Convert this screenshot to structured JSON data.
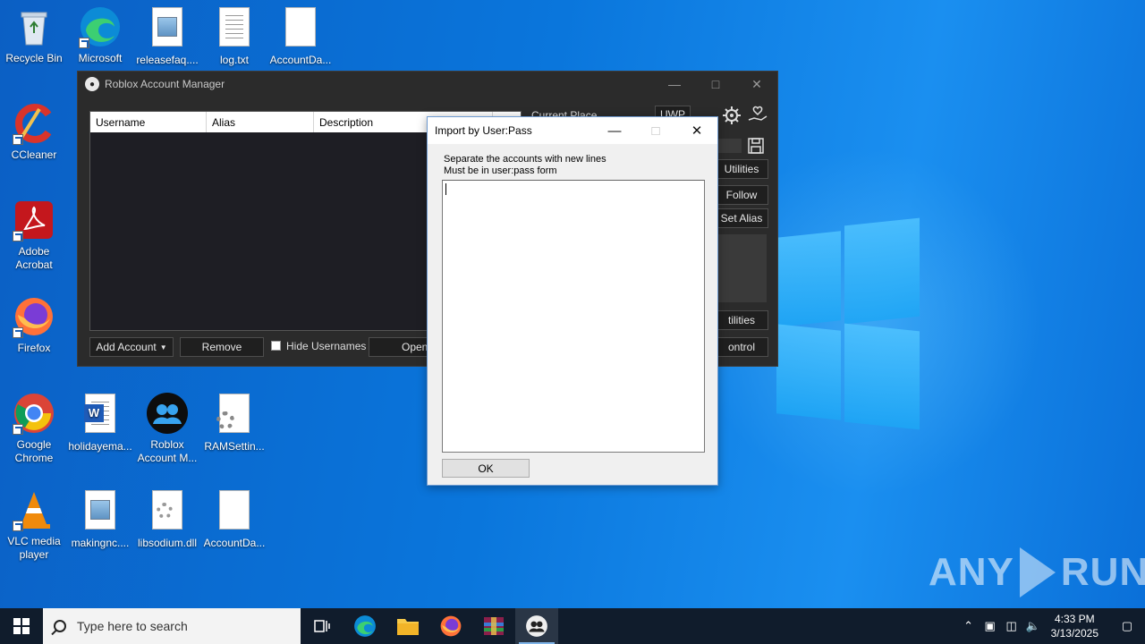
{
  "desktop": {
    "icons": [
      {
        "label": "Recycle Bin"
      },
      {
        "label": "Microsoft Edge"
      },
      {
        "label": "releasefaq...."
      },
      {
        "label": "log.txt"
      },
      {
        "label": "AccountDa..."
      },
      {
        "label": "CCleaner"
      },
      {
        "label": "Adobe Acrobat"
      },
      {
        "label": "Firefox"
      },
      {
        "label": "Google Chrome"
      },
      {
        "label": "holidayema..."
      },
      {
        "label": "Roblox Account M..."
      },
      {
        "label": "RAMSettin..."
      },
      {
        "label": "VLC media player"
      },
      {
        "label": "makingnc...."
      },
      {
        "label": "libsodium.dll"
      },
      {
        "label": "AccountDa..."
      }
    ]
  },
  "app": {
    "title": "Roblox Account Manager",
    "columns": [
      "Username",
      "Alias",
      "Description"
    ],
    "current_place_label": "Current Place",
    "uwp_label": "UWP",
    "buttons": {
      "add_account": "Add Account",
      "remove": "Remove",
      "hide_usernames": "Hide Usernames",
      "open": "Open",
      "utilities": "Utilities",
      "follow": "Follow",
      "set_alias": "Set Alias",
      "utilities_2": "tilities",
      "control": "ontrol"
    }
  },
  "dialog": {
    "title": "Import by User:Pass",
    "instruction_line1": "Separate the accounts with new lines",
    "instruction_line2": "Must be in user:pass form",
    "textarea_value": "",
    "ok_label": "OK"
  },
  "watermark": {
    "left": "ANY",
    "right": "RUN"
  },
  "taskbar": {
    "search_placeholder": "Type here to search",
    "time": "4:33 PM",
    "date": "3/13/2025"
  },
  "colors": {
    "desktop_blue": "#0a76dc",
    "taskbar": "#101c2c",
    "app_bg": "#2b2b2b",
    "grid_bg": "#1e1e24"
  }
}
